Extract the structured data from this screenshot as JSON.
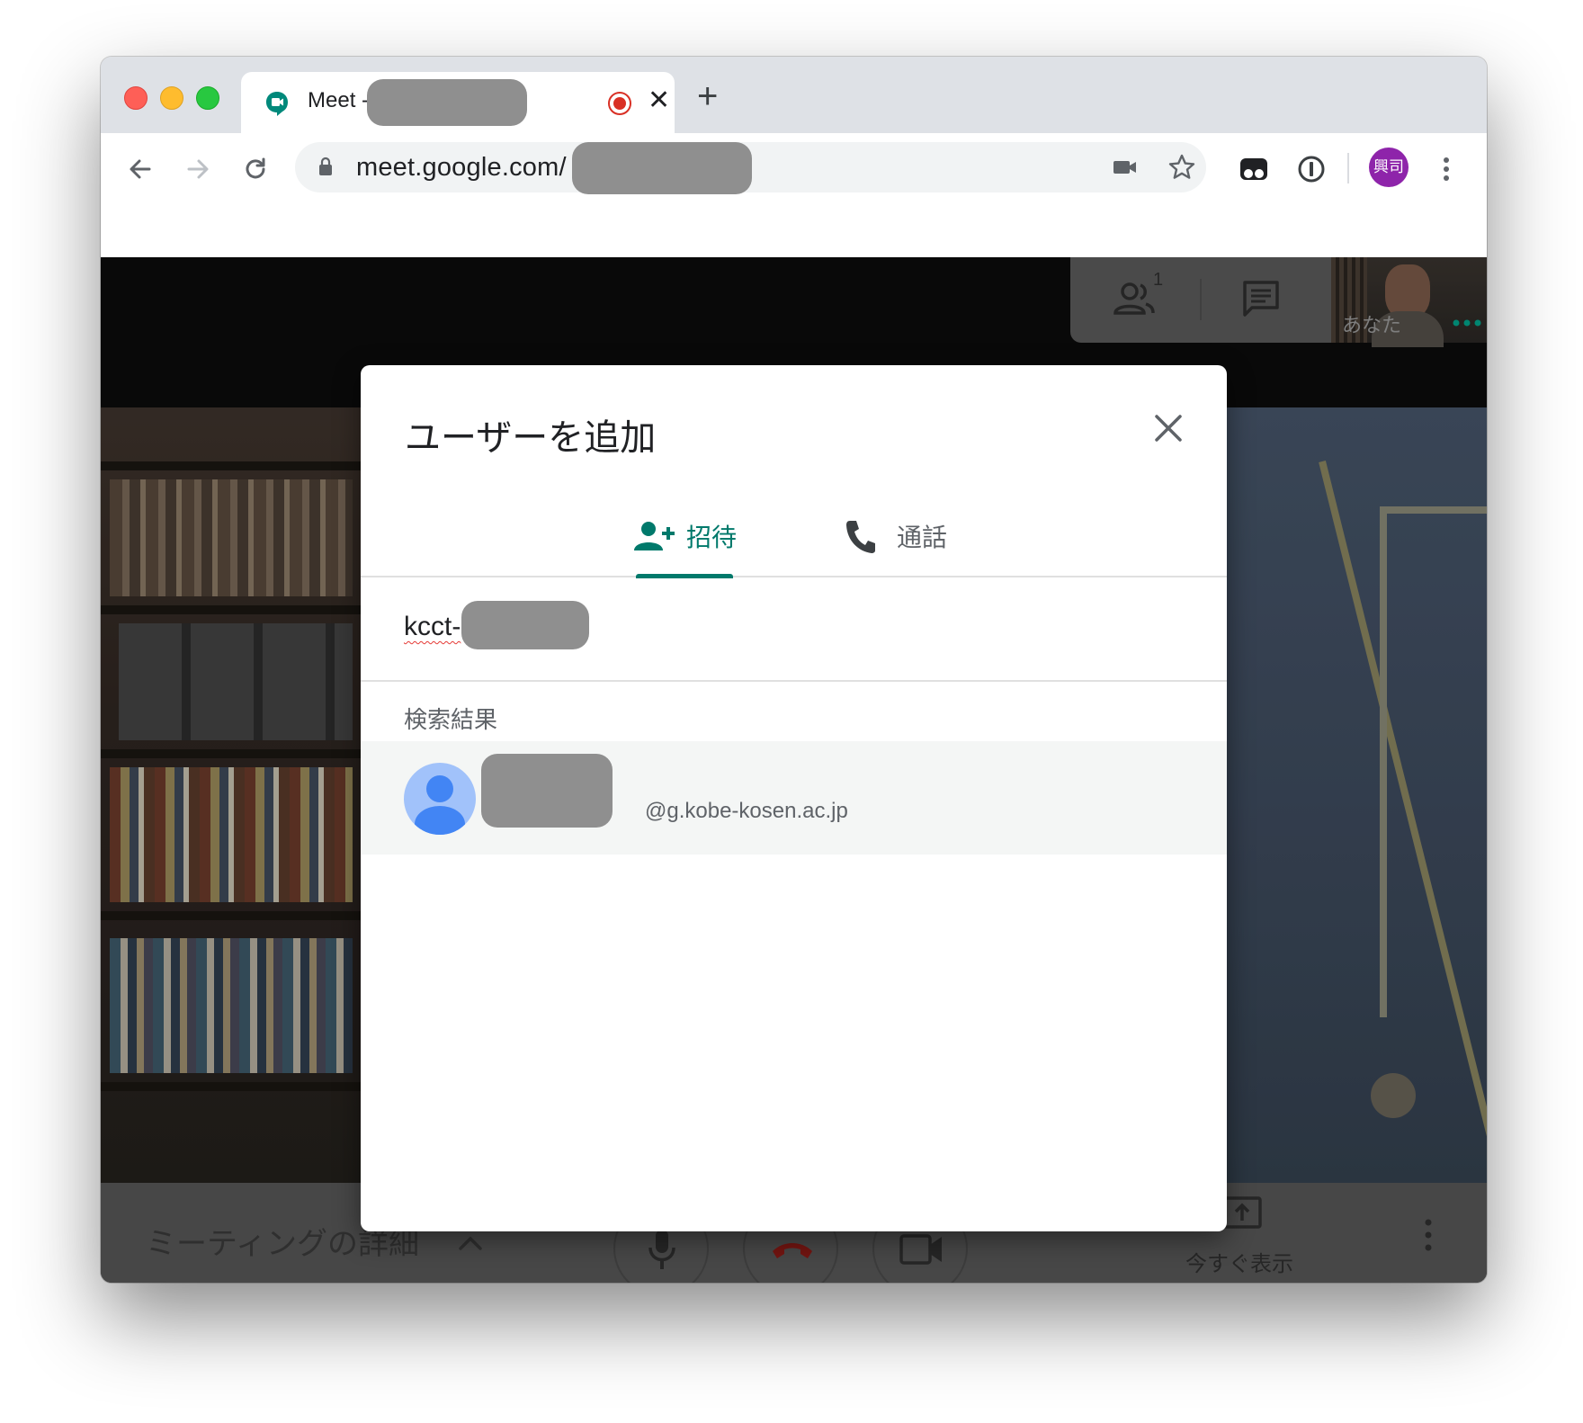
{
  "browser": {
    "tab_title": "Meet - ",
    "new_tab_label": "+",
    "tab_close": "✕",
    "url": "meet.google.com/",
    "profile_initials": "興司"
  },
  "meet": {
    "self_view_label": "あなた",
    "participant_count": "1",
    "meeting_details_label": "ミーティングの詳細",
    "present_now_label": "今すぐ表示"
  },
  "dialog": {
    "title": "ユーザーを追加",
    "tabs": [
      {
        "label": "招待",
        "active": true
      },
      {
        "label": "通話",
        "active": false
      }
    ],
    "input_value": "kcct-",
    "results_label": "検索結果",
    "result": {
      "email_suffix": "@g.kobe-kosen.ac.jp"
    }
  },
  "colors": {
    "accent": "#00796b",
    "profile": "#8e24aa",
    "hangup": "#c5221f"
  }
}
